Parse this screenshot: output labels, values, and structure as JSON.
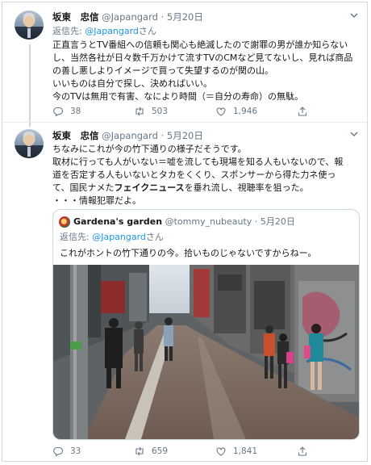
{
  "tweet1": {
    "name": "坂東　忠信",
    "handle": "@Japangard",
    "date": "5月20日",
    "reply_label": "返信先: ",
    "reply_mention": "@Japangard",
    "reply_suffix": "さん",
    "lines": [
      "正直言うとTV番組への信頼も関心も絶滅したので謝罪の男が誰か知らない",
      "し、当然各社が日々数千万かけて流すTVのCMなど見てないし、見れば商品",
      "の善し悪しよりイメージで買って失望するのが関の山。",
      "いいものは自分で探し、決めればいい。",
      "今のTVは無用で有害、なにより時間（＝自分の寿命）の無駄。"
    ],
    "reply_count": "38",
    "retweet_count": "503",
    "like_count": "1,946"
  },
  "tweet2": {
    "name": "坂東　忠信",
    "handle": "@Japangard",
    "date": "5月20日",
    "lines": [
      "ちなみにこれが今の竹下通りの様子だそうです。",
      "取材に行っても人がいない＝嘘を流しても現場を知る人もいないので、報",
      "道を否定する人もいないとタカをくくり、スポンサーから得た力ネ使っ"
    ],
    "line4_before": "て、国民ナメた",
    "line4_bold": "フェイクニュース",
    "line4_after": "を垂れ流し、視聴率を狙った。",
    "line5": "・・・情報犯罪だよ。",
    "reply_count": "33",
    "retweet_count": "659",
    "like_count": "1,841"
  },
  "quote": {
    "name": "Gardena's garden",
    "handle": "@tommy_nubeauty",
    "date": "5月20日",
    "reply_label": "返信先: ",
    "reply_mention": "@Japangard",
    "reply_suffix": "さん",
    "text": "これがホントの竹下通りの今。拾いものじゃないですからねー。"
  },
  "icons": {
    "reply": "speech-bubble-icon",
    "retweet": "retweet-arrows-icon",
    "like": "heart-icon",
    "menu": "chevron-down-icon"
  },
  "colors": {
    "link": "#1b95e0",
    "meta": "#657786",
    "text": "#14171a",
    "border": "#ccd6dd"
  }
}
